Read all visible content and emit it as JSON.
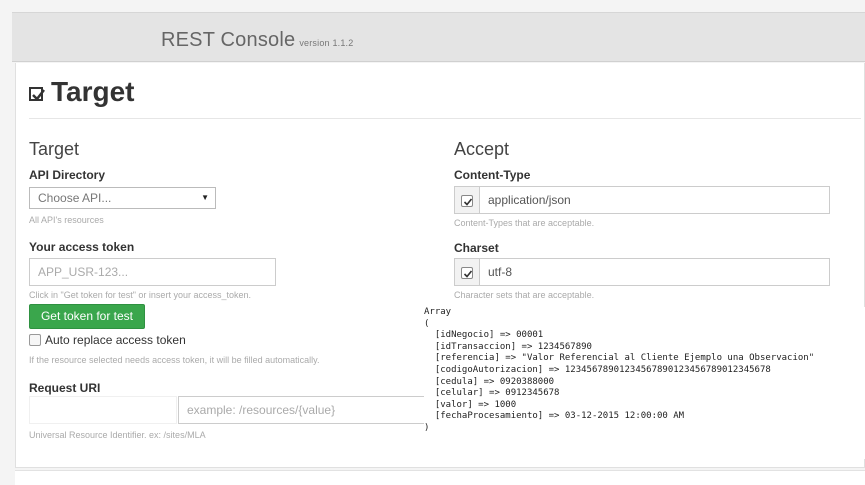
{
  "header": {
    "app_title": "REST Console",
    "version": "version 1.1.2"
  },
  "section": {
    "title": "Target"
  },
  "target": {
    "title": "Target",
    "api_directory_label": "API Directory",
    "api_select_value": "Choose API...",
    "api_help": "All API's resources",
    "token_label": "Your access token",
    "token_placeholder": "APP_USR-123...",
    "token_help": "Click in \"Get token for test\" or insert your access_token.",
    "get_token_button": "Get token for test",
    "auto_replace_label": "Auto replace access token",
    "auto_replace_help": "If the resource selected needs access token, it will be filled automatically.",
    "request_uri_label": "Request URI",
    "uri_placeholder": "example: /resources/{value}",
    "uri_help": "Universal Resource Identifier. ex: /sites/MLA"
  },
  "accept": {
    "title": "Accept",
    "content_type_label": "Content-Type",
    "content_type_value": "application/json",
    "content_type_help": "Content-Types that are acceptable.",
    "charset_label": "Charset",
    "charset_value": "utf-8",
    "charset_help": "Character sets that are acceptable."
  },
  "dump": {
    "lines": [
      "Array",
      "(",
      "  [idNegocio] => 00001",
      "  [idTransaccion] => 1234567890",
      "  [referencia] => \"Valor Referencial al Cliente Ejemplo una Observacion\"",
      "  [codigoAutorizacion] => 12345678901234567890123456789012345678",
      "  [cedula] => 0920388000",
      "  [celular] => 0912345678",
      "  [valor] => 1000",
      "  [fechaProcesamiento] => 03-12-2015 12:00:00 AM",
      ")"
    ]
  }
}
